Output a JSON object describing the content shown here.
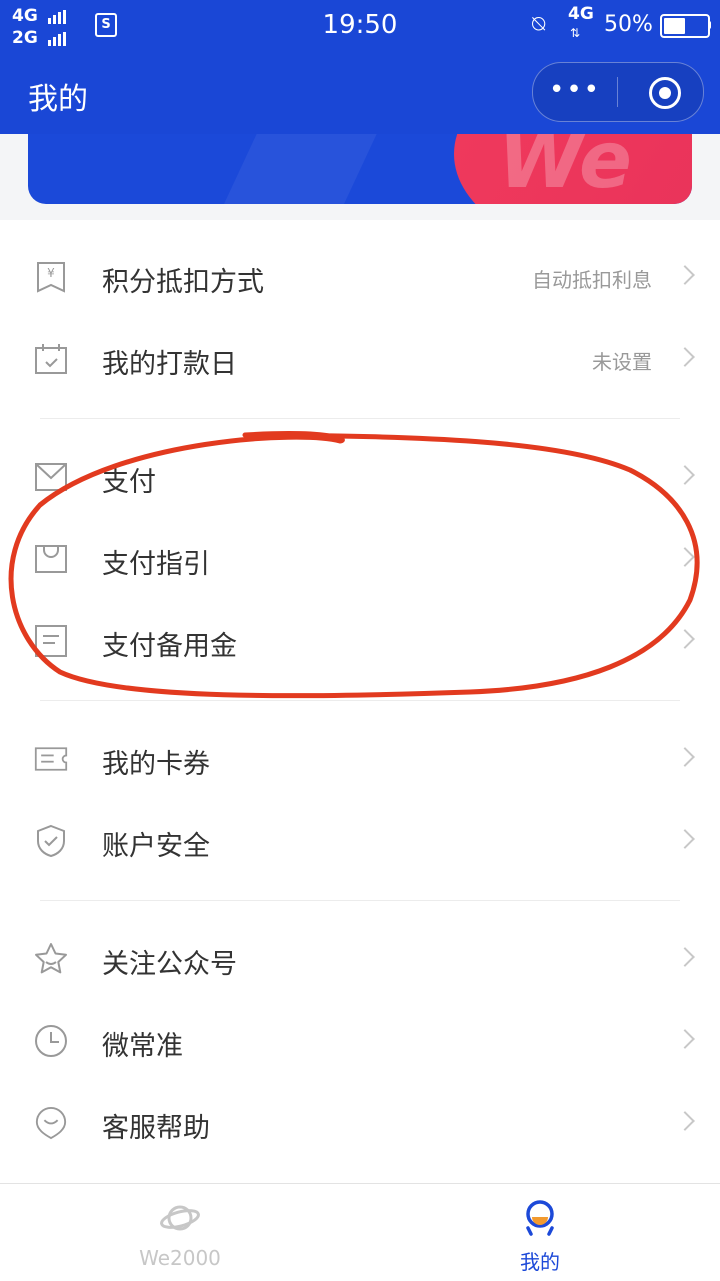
{
  "status_bar": {
    "signal_1": "4G",
    "signal_2": "2G",
    "sim_label": "S",
    "time": "19:50",
    "network": "4G",
    "battery": "50%",
    "battery_level": 0.5
  },
  "header": {
    "title": "我的"
  },
  "banner": {
    "logo_text": "We"
  },
  "menu_groups": [
    {
      "items": [
        {
          "label": "积分抵扣方式",
          "value": "自动抵扣利息",
          "icon": "yen-tag-icon"
        },
        {
          "label": "我的打款日",
          "value": "未设置",
          "icon": "calendar-check-icon"
        }
      ]
    },
    {
      "items": [
        {
          "label": "支付",
          "value": "",
          "icon": "envelope-icon"
        },
        {
          "label": "支付指引",
          "value": "",
          "icon": "bag-icon"
        },
        {
          "label": "支付备用金",
          "value": "",
          "icon": "document-icon"
        }
      ]
    },
    {
      "items": [
        {
          "label": "我的卡券",
          "value": "",
          "icon": "coupon-icon"
        },
        {
          "label": "账户安全",
          "value": "",
          "icon": "shield-icon"
        }
      ]
    },
    {
      "items": [
        {
          "label": "关注公众号",
          "value": "",
          "icon": "star-icon"
        },
        {
          "label": "微常准",
          "value": "",
          "icon": "clock-icon"
        },
        {
          "label": "客服帮助",
          "value": "",
          "icon": "chat-heart-icon"
        }
      ]
    }
  ],
  "tabbar": {
    "tabs": [
      {
        "label": "We2000",
        "icon": "planet-icon",
        "active": false
      },
      {
        "label": "我的",
        "icon": "user-icon",
        "active": true
      }
    ]
  },
  "colors": {
    "brand_blue": "#1a47d6",
    "annotation_red": "#e23a1f"
  }
}
